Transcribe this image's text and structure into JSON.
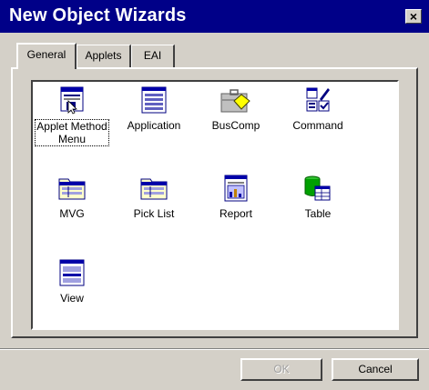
{
  "window": {
    "title": "New Object Wizards",
    "close_glyph": "×"
  },
  "tabs": [
    {
      "label": "General",
      "active": true
    },
    {
      "label": "Applets",
      "active": false
    },
    {
      "label": "EAI",
      "active": false
    }
  ],
  "items": [
    {
      "label_line1": "Applet Method",
      "label_line2": "Menu",
      "icon": "applet-method-menu-icon",
      "selected": true
    },
    {
      "label": "Application",
      "icon": "application-icon"
    },
    {
      "label": "BusComp",
      "icon": "buscomp-icon"
    },
    {
      "label": "Command",
      "icon": "command-icon"
    },
    {
      "label": "MVG",
      "icon": "mvg-icon"
    },
    {
      "label": "Pick List",
      "icon": "pick-list-icon"
    },
    {
      "label": "Report",
      "icon": "report-icon"
    },
    {
      "label": "Table",
      "icon": "table-icon"
    },
    {
      "label": "View",
      "icon": "view-icon"
    }
  ],
  "buttons": {
    "ok": "OK",
    "ok_enabled": false,
    "cancel": "Cancel"
  },
  "colors": {
    "title_bar": "#000088",
    "face": "#d4d0c8",
    "accent_blue": "#0000a8"
  }
}
